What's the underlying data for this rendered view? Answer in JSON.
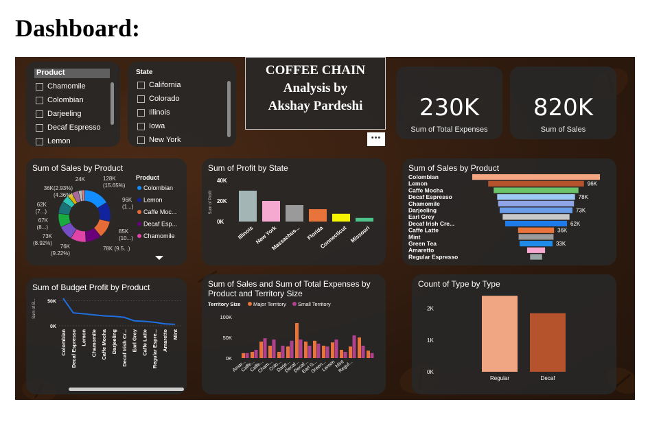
{
  "page_title": "Dashboard:",
  "slicer_product": {
    "header": "Product",
    "items": [
      "Chamomile",
      "Colombian",
      "Darjeeling",
      "Decaf Espresso",
      "Lemon"
    ]
  },
  "slicer_state": {
    "header": "State",
    "items": [
      "California",
      "Colorado",
      "Illinois",
      "Iowa",
      "New York"
    ]
  },
  "title_box": {
    "line1": "COFFEE CHAIN",
    "line2": "Analysis by",
    "line3": "Akshay Pardeshi",
    "more_label": "•••"
  },
  "kpis": [
    {
      "value": "230K",
      "label": "Sum of Total Expenses"
    },
    {
      "value": "820K",
      "label": "Sum of Sales"
    }
  ],
  "colors": {
    "background": "#2e1a0e",
    "card": "#282828",
    "accent_blue": "#1f6fe0"
  },
  "chart_data": [
    {
      "id": "donut",
      "type": "pie",
      "title": "Sum of Sales by Product",
      "legend_title": "Product",
      "legend": [
        {
          "name": "Colombian",
          "color": "#118dff"
        },
        {
          "name": "Lemon",
          "color": "#12239e"
        },
        {
          "name": "Caffe Moc...",
          "color": "#e66c37"
        },
        {
          "name": "Decaf Esp...",
          "color": "#6b007b"
        },
        {
          "name": "Chamomile",
          "color": "#e044a7"
        }
      ],
      "slices": [
        {
          "name": "Colombian",
          "value": 128,
          "color": "#118dff"
        },
        {
          "name": "Lemon",
          "value": 96,
          "color": "#12239e"
        },
        {
          "name": "Caffe Mocha",
          "value": 85,
          "color": "#e66c37"
        },
        {
          "name": "Decaf Espresso",
          "value": 78,
          "color": "#6b007b"
        },
        {
          "name": "Chamomile",
          "value": 76,
          "color": "#e044a7"
        },
        {
          "name": "Darjeeling",
          "value": 73,
          "color": "#744ec2"
        },
        {
          "name": "Decaf Irish Cream",
          "value": 67,
          "color": "#1aab40"
        },
        {
          "name": "Earl Grey",
          "value": 62,
          "color": "#197278"
        },
        {
          "name": "Caffe Latte",
          "value": 36,
          "color": "#2ec4b6"
        },
        {
          "name": "Mint",
          "value": 24,
          "color": "#d9b300"
        },
        {
          "name": "Green Tea",
          "value": 33,
          "color": "#a66999"
        },
        {
          "name": "Amaretto",
          "value": 18,
          "color": "#b8b8b8"
        },
        {
          "name": "Regular Espresso",
          "value": 12,
          "color": "#f08080"
        }
      ],
      "labels": [
        {
          "text": "128K",
          "sub": "(15.65%)"
        },
        {
          "text": "96K",
          "sub": "(1...)"
        },
        {
          "text": "85K",
          "sub": "(10...)"
        },
        {
          "text": "78K (9.5...)",
          "sub": ""
        },
        {
          "text": "76K",
          "sub": "(9.22%)"
        },
        {
          "text": "73K",
          "sub": "(8.92%)"
        },
        {
          "text": "67K",
          "sub": "(8...)"
        },
        {
          "text": "62K",
          "sub": "(7...)"
        },
        {
          "text": "36K(2.93%)",
          "sub": "(4.36%)"
        },
        {
          "text": "24K",
          "sub": ""
        }
      ]
    },
    {
      "id": "profit_state",
      "type": "bar",
      "title": "Sum of Profit by State",
      "ylabel": "Sum of Profit",
      "yticks": [
        "40K",
        "20K",
        "0K"
      ],
      "ylim": [
        0,
        40000
      ],
      "categories": [
        "Illinois",
        "New York",
        "Massachus...",
        "Florida",
        "Connecticut",
        "Missouri"
      ],
      "values": [
        30000,
        20000,
        16000,
        12000,
        7500,
        3500
      ],
      "colors": [
        "#a3b5b5",
        "#f5a8d0",
        "#9a9a9a",
        "#e8743b",
        "#f5f500",
        "#4fc48a"
      ]
    },
    {
      "id": "funnel",
      "type": "bar",
      "title": "Sum of Sales by Product",
      "categories": [
        "Colombian",
        "Lemon",
        "Caffe Mocha",
        "Decaf Espresso",
        "Chamomile",
        "Darjeeling",
        "Earl Grey",
        "Decaf Irish Cre...",
        "Caffe Latte",
        "Mint",
        "Green Tea",
        "Amaretto",
        "Regular Espresso"
      ],
      "values": [
        128,
        96,
        85,
        78,
        76,
        73,
        67,
        62,
        36,
        35,
        33,
        18,
        12
      ],
      "value_labels": [
        "",
        "96K",
        "",
        "78K",
        "",
        "73K",
        "",
        "62K",
        "36K",
        "",
        "33K",
        "",
        ""
      ],
      "colors": [
        "#f4a582",
        "#b5532d",
        "#6cc36a",
        "#9ec9f5",
        "#8fa5e8",
        "#6b9de8",
        "#c9c9c9",
        "#1f7be8",
        "#e8743b",
        "#9a9a9a",
        "#1f8ae8",
        "#f5a8d0",
        "#9aa5a5"
      ]
    },
    {
      "id": "budget_line",
      "type": "line",
      "title": "Sum of Budget Profit by Product",
      "ylabel": "Sum of B...",
      "yticks": [
        "50K",
        "0K"
      ],
      "ylim": [
        0,
        55000
      ],
      "categories": [
        "Colombian",
        "Decaf Espresso",
        "Lemon",
        "Chamomile",
        "Caffe Mocha",
        "Darjeeling",
        "Decaf Irish Cr...",
        "Earl Grey",
        "Caffe Latte",
        "Regular Espre...",
        "Amaretto",
        "Mint"
      ],
      "values": [
        55000,
        26000,
        24000,
        22000,
        20000,
        19000,
        17000,
        10000,
        9000,
        7000,
        4000,
        3000
      ],
      "color": "#1f6fe0"
    },
    {
      "id": "sales_expenses",
      "type": "bar",
      "title": "Sum of Sales and Sum of Total Expenses by Product and Territory Size",
      "legend_title": "Territory Size",
      "series": [
        {
          "name": "Major Territory",
          "color": "#e8743b",
          "values": [
            12,
            15,
            40,
            30,
            15,
            28,
            85,
            40,
            42,
            30,
            38,
            20,
            28,
            50,
            18
          ]
        },
        {
          "name": "Small Territory",
          "color": "#b0418f",
          "values": [
            12,
            20,
            48,
            45,
            30,
            42,
            45,
            30,
            35,
            28,
            45,
            15,
            55,
            30,
            12
          ]
        }
      ],
      "categories": [
        "Amar...",
        "Caffe...",
        "Caffe...",
        "Cham...",
        "Colo...",
        "Darje...",
        "Decaf...",
        "Decaf...",
        "Earl G...",
        "Green...",
        "Lemon",
        "Mint",
        "Regul...",
        "",
        ""
      ],
      "yticks": [
        "100K",
        "50K",
        "0K"
      ],
      "ylim": [
        0,
        100
      ]
    },
    {
      "id": "type_count",
      "type": "bar",
      "title": "Count of Type by Type",
      "categories": [
        "Regular",
        "Decaf"
      ],
      "values": [
        2400,
        1850
      ],
      "yticks": [
        "2K",
        "1K",
        "0K"
      ],
      "ylim": [
        0,
        2600
      ],
      "colors": [
        "#f0a583",
        "#b5532d"
      ]
    }
  ]
}
